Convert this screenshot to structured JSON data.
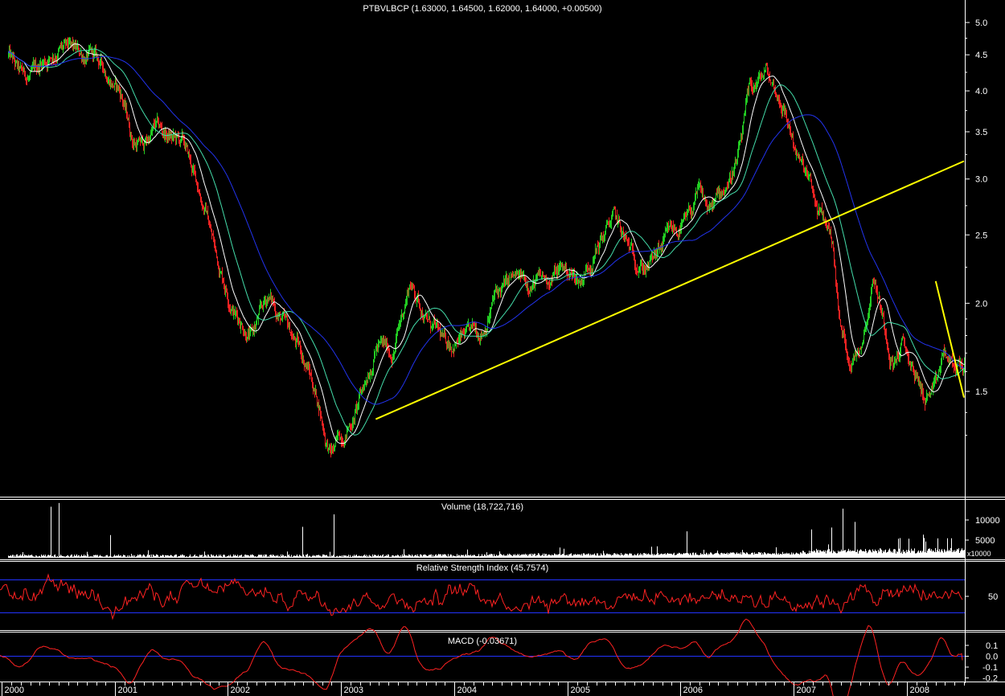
{
  "chart_data": [
    {
      "type": "candlestick",
      "title": "PTBVLBCP (1.63000, 1.64500, 1.62000, 1.64000, +0.00500)",
      "y_scale": "log",
      "ylim": [
        1.15,
        5.3
      ],
      "y_ticks": [
        "1.5",
        "2.0",
        "2.5",
        "3.0",
        "3.5",
        "4.0",
        "4.5",
        "5.0"
      ],
      "x_ticks": [
        "2000",
        "2001",
        "2002",
        "2003",
        "2004",
        "2005",
        "2006",
        "2007",
        "2008"
      ],
      "close_series": {
        "x": [
          2000.0,
          2000.1,
          2000.2,
          2000.3,
          2000.45,
          2000.6,
          2000.75,
          2000.9,
          2001.0,
          2001.1,
          2001.2,
          2001.3,
          2001.4,
          2001.55,
          2001.65,
          2001.75,
          2001.85,
          2002.0,
          2002.15,
          2002.3,
          2002.45,
          2002.55,
          2002.65,
          2002.75,
          2002.8,
          2002.85,
          2002.95,
          2003.05,
          2003.1,
          2003.18,
          2003.25,
          2003.4,
          2003.55,
          2003.7,
          2003.85,
          2004.0,
          2004.1,
          2004.2,
          2004.3,
          2004.45,
          2004.6,
          2004.75,
          2004.9,
          2005.05,
          2005.2,
          2005.35,
          2005.5,
          2005.65,
          2005.75,
          2005.85,
          2006.0,
          2006.1,
          2006.2,
          2006.3,
          2006.45,
          2006.55,
          2006.7,
          2006.85,
          2007.0,
          2007.08,
          2007.15,
          2007.28,
          2007.35,
          2007.45,
          2007.55,
          2007.65,
          2007.75,
          2007.82,
          2007.9,
          2008.0,
          2008.1,
          2008.2,
          2008.27,
          2008.35,
          2008.4
        ],
        "close": [
          4.5,
          4.2,
          4.15,
          4.4,
          4.6,
          4.5,
          4.45,
          4.2,
          3.95,
          3.4,
          3.35,
          3.55,
          3.45,
          3.35,
          3.0,
          2.7,
          2.3,
          1.95,
          1.8,
          2.05,
          1.85,
          1.75,
          1.62,
          1.43,
          1.3,
          1.22,
          1.3,
          1.38,
          1.45,
          1.6,
          1.75,
          1.7,
          2.15,
          1.9,
          1.75,
          1.78,
          1.8,
          1.85,
          2.05,
          2.15,
          2.15,
          2.15,
          2.25,
          2.15,
          2.4,
          2.65,
          2.35,
          2.25,
          2.35,
          2.5,
          2.6,
          2.85,
          2.7,
          2.85,
          3.2,
          3.95,
          4.25,
          3.8,
          3.15,
          2.95,
          2.7,
          2.5,
          1.85,
          1.65,
          1.8,
          2.2,
          1.85,
          1.65,
          1.75,
          1.6,
          1.47,
          1.5,
          1.7,
          1.6,
          1.64
        ]
      },
      "moving_averages": [
        {
          "color": "#ffffff",
          "period": "short"
        },
        {
          "color": "#44ddaa",
          "period": "medium"
        },
        {
          "color": "#2233ee",
          "period": "long"
        }
      ],
      "trendlines": [
        {
          "color": "#ffff00",
          "from": [
            2003.25,
            1.37
          ],
          "to": [
            2008.45,
            3.18
          ]
        },
        {
          "color": "#ffff00",
          "from": [
            2008.2,
            2.15
          ],
          "to": [
            2008.45,
            1.47
          ]
        }
      ],
      "up_color": "#22cc22",
      "down_color": "#ee2222"
    },
    {
      "type": "bar",
      "title": "Volume (18,722,716)",
      "y_ticks": [
        "5000",
        "10000"
      ],
      "scale_label": "x10000",
      "spikes": [
        {
          "x": 2000.38,
          "value": 13500
        },
        {
          "x": 2000.45,
          "value": 14500
        },
        {
          "x": 2000.9,
          "value": 6000
        },
        {
          "x": 2002.88,
          "value": 11500
        },
        {
          "x": 2002.6,
          "value": 8200
        },
        {
          "x": 2007.38,
          "value": 13000
        },
        {
          "x": 2007.28,
          "value": 8000
        },
        {
          "x": 2007.48,
          "value": 9500
        },
        {
          "x": 2007.1,
          "value": 7500
        },
        {
          "x": 2006.0,
          "value": 7000
        }
      ]
    },
    {
      "type": "line",
      "title": "Relative Strength Index (45.7574)",
      "y_ticks": [
        "50"
      ],
      "bands": [
        70,
        30
      ],
      "last_value": 45.7574,
      "color": "#ff2222"
    },
    {
      "type": "line",
      "title": "MACD (-0.03671)",
      "y_ticks": [
        "0.1",
        "0.0",
        "-0.1",
        "-0.2"
      ],
      "last_value": -0.03671,
      "color": "#ff2222"
    }
  ]
}
